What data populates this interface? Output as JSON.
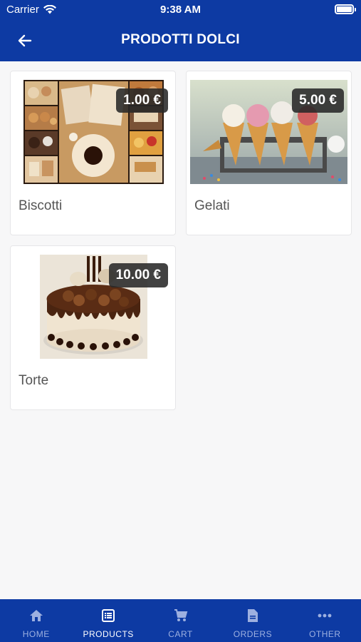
{
  "status_bar": {
    "carrier": "Carrier",
    "time": "9:38 AM"
  },
  "header": {
    "title": "PRODOTTI DOLCI",
    "back_icon": "arrow-left-icon"
  },
  "products": [
    {
      "name": "Biscotti",
      "price": "1.00 €",
      "image": "cookies-collage"
    },
    {
      "name": "Gelati",
      "price": "5.00 €",
      "image": "ice-cream-cones"
    },
    {
      "name": "Torte",
      "price": "10.00 €",
      "image": "chocolate-cake"
    }
  ],
  "tab_bar": {
    "active_color": "#ffffff",
    "inactive_color": "#9db0e0",
    "background": "#0d3aa3",
    "tabs": [
      {
        "label": "HOME",
        "icon": "home-icon",
        "active": false
      },
      {
        "label": "PRODUCTS",
        "icon": "list-icon",
        "active": true
      },
      {
        "label": "CART",
        "icon": "cart-icon",
        "active": false
      },
      {
        "label": "ORDERS",
        "icon": "document-icon",
        "active": false
      },
      {
        "label": "OTHER",
        "icon": "more-icon",
        "active": false
      }
    ]
  }
}
